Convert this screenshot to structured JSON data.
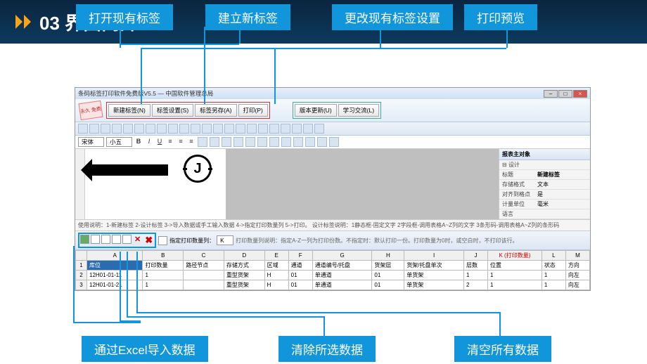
{
  "header": {
    "number": "03",
    "title": "界面简介"
  },
  "callouts": {
    "open_label": "打开现有标签",
    "new_label": "建立新标签",
    "settings": "更改现有标签设置",
    "preview": "打印预览",
    "excel_import": "通过Excel导入数据",
    "clear_selected": "清除所选数据",
    "clear_all": "清空所有数据"
  },
  "app": {
    "title": "条码标签打印软件免费版V5.5 — 中国软件管理总局",
    "stamp": "永久\n免费",
    "ribbon": {
      "new": "新建标签(N)",
      "settings": "标签设置(S)",
      "saveas": "标签另存(A)",
      "print": "打印(P)",
      "update": "版本更新(U)",
      "learn": "学习交流(L)"
    },
    "font_label": "宋体",
    "size_label": "小五",
    "hint": "使用说明：1-新建标签 2-设计标签 3->导入数据或手工输入数据 4->指定打印数量列 5->打印。 设计标签说明：1静态框-固定文字  2字段框-调用表格A~Z列的文字  3条形码-调用表格A~Z列的条形码",
    "gridtools_text": "指定打印数量列：",
    "gridtools_hint": "打印数量列说明：指定A-Z一列为打印份数。不指定时：默认打印一份。打印数量为0时，或空白时，不打印该行。",
    "props": {
      "header": "报表主对象",
      "design": "设计",
      "name_k": "标题",
      "name_v": "新建标签",
      "format_k": "存储格式",
      "format_v": "文本",
      "snap_k": "对齐到格点",
      "snap_v": "是",
      "unit_k": "计量单位",
      "unit_v": "毫米",
      "lang_k": "语言",
      "lang_v": ""
    },
    "grid": {
      "cols": [
        "",
        "A",
        "B",
        "C",
        "D",
        "E",
        "F",
        "G",
        "H",
        "I",
        "J",
        "K (打印数量)",
        "L",
        "M"
      ],
      "row1": [
        "1",
        "库位",
        "打印数量",
        "路径节点",
        "存储方式",
        "区域",
        "通道",
        "通道编号/托盘",
        "货架层",
        "货架/托盘单次",
        "层数",
        "位置",
        "状态",
        "方向"
      ],
      "row2": [
        "2",
        "12H01-01-11",
        "1",
        "",
        "重型货架",
        "H",
        "01",
        "单通道",
        "01",
        "单货架",
        "1",
        "1",
        "1",
        "向左"
      ],
      "row3": [
        "3",
        "12H01-01-21",
        "1",
        "",
        "重型货架",
        "H",
        "01",
        "单通道",
        "01",
        "单货架",
        "2",
        "1",
        "1",
        "向左"
      ]
    }
  }
}
